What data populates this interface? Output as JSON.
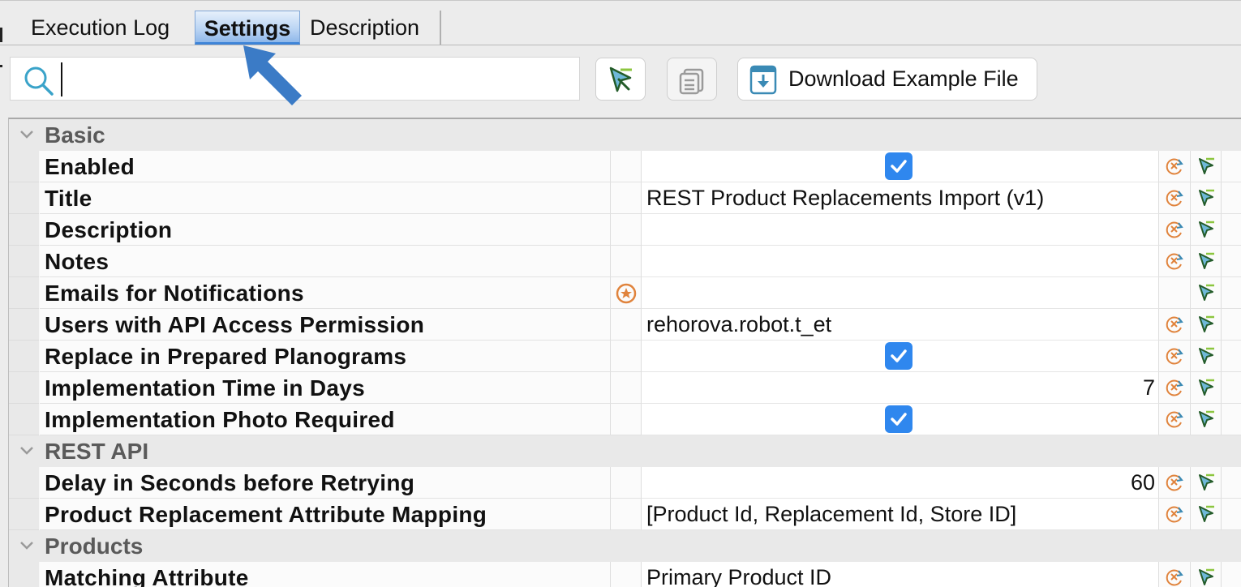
{
  "tabs": [
    {
      "label": "Execution Log",
      "active": false
    },
    {
      "label": "Settings",
      "active": true
    },
    {
      "label": "Description",
      "active": false
    }
  ],
  "toolbar": {
    "search_value": "",
    "search_placeholder": "",
    "download_label": "Download Example File",
    "pick_icon": "pick-arrow-icon",
    "paste_icon": "clipboard-icon",
    "download_icon": "download-file-icon"
  },
  "colors": {
    "accent": "#2f87ee",
    "annotation_arrow": "#3b7bc6",
    "reset_icon": "#e0833c",
    "pick_icon": "#5a8a2a"
  },
  "groups": {
    "basic": "Basic",
    "rest_api": "REST API",
    "products": "Products"
  },
  "props": {
    "enabled": {
      "name": "Enabled",
      "checked": true
    },
    "title": {
      "name": "Title",
      "value": "REST Product Replacements Import (v1)"
    },
    "description": {
      "name": "Description",
      "value": ""
    },
    "notes": {
      "name": "Notes",
      "value": ""
    },
    "emails": {
      "name": "Emails for Notifications",
      "value": ""
    },
    "users": {
      "name": "Users with API Access Permission",
      "value": "rehorova.robot.t_et"
    },
    "replace": {
      "name": "Replace in Prepared Planograms",
      "checked": true
    },
    "impl_time": {
      "name": "Implementation Time in Days",
      "value": "7"
    },
    "impl_photo": {
      "name": "Implementation Photo Required",
      "checked": true
    },
    "delay": {
      "name": "Delay in Seconds before Retrying",
      "value": "60"
    },
    "mapping": {
      "name": "Product Replacement Attribute Mapping",
      "value": "[Product Id, Replacement Id, Store ID]"
    },
    "matching": {
      "name": "Matching Attribute",
      "value": "Primary Product ID"
    }
  }
}
